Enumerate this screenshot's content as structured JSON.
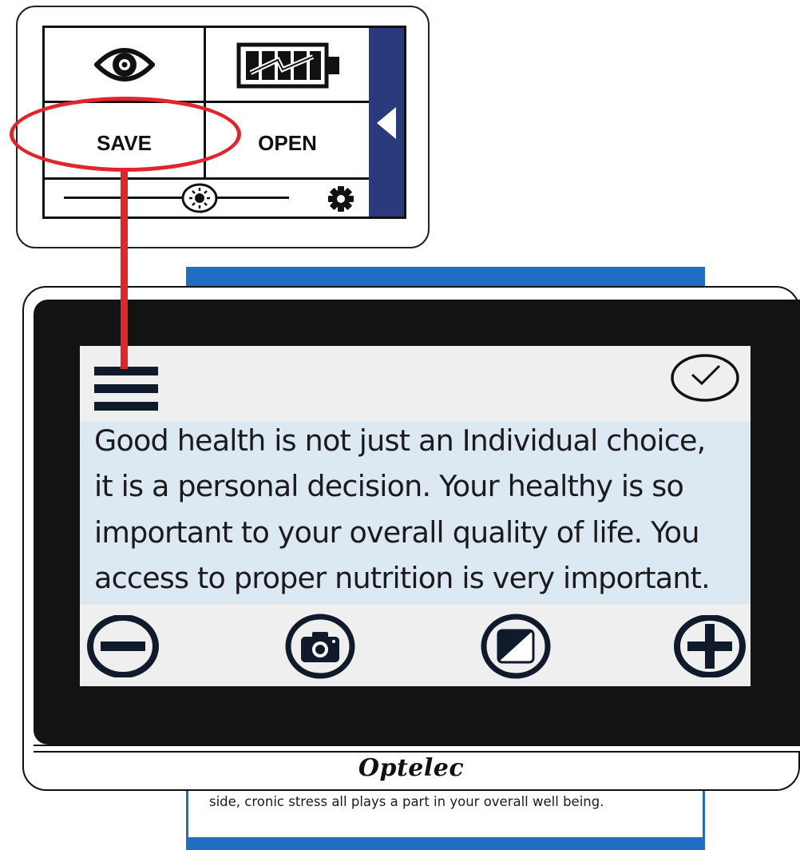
{
  "popup": {
    "cells": {
      "eye_settings_icon": "eye-gear-icon",
      "battery_icon": "battery-charging-icon",
      "save_label": "SAVE",
      "open_label": "OPEN"
    },
    "brightness_icon": "sun-icon",
    "settings_icon": "gear-icon",
    "collapse_icon": "triangle-left-icon"
  },
  "display": {
    "lines": [
      "Good health is not just an Individual choice,",
      "it is a personal decision. Your healthy is so",
      "important to your overall quality of life. You",
      "access to proper nutrition is very important."
    ],
    "controls": [
      "zoom-out-icon",
      "camera-icon",
      "contrast-icon",
      "zoom-in-icon"
    ],
    "menu_icon": "hamburger-menu-icon",
    "confirm_icon": "check-circle-icon"
  },
  "device": {
    "brand": "Optelec"
  },
  "document": {
    "bottom_text": "side, cronic stress all plays a part in your overall well being."
  },
  "colors": {
    "highlight": "#e2252b",
    "side_tab": "#2b3a7d",
    "document_band": "#1f6ec2",
    "reading_bg": "#dce8f2",
    "screen_bg": "#efefef"
  }
}
